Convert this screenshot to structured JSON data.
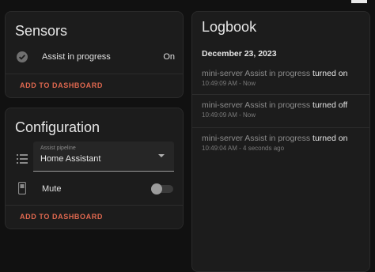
{
  "sensors": {
    "title": "Sensors",
    "item_label": "Assist in progress",
    "item_value": "On",
    "action_label": "ADD TO DASHBOARD"
  },
  "configuration": {
    "title": "Configuration",
    "pipeline_label": "Assist pipeline",
    "pipeline_value": "Home Assistant",
    "mute_label": "Mute",
    "mute_on": false,
    "action_label": "ADD TO DASHBOARD"
  },
  "logbook": {
    "title": "Logbook",
    "date": "December 23, 2023",
    "entries": [
      {
        "entity": "mini-server Assist in progress",
        "action": "turned on",
        "time": "10:49:09 AM",
        "relative": "Now"
      },
      {
        "entity": "mini-server Assist in progress",
        "action": "turned off",
        "time": "10:49:09 AM",
        "relative": "Now"
      },
      {
        "entity": "mini-server Assist in progress",
        "action": "turned on",
        "time": "10:49:04 AM",
        "relative": "4 seconds ago"
      }
    ]
  },
  "colors": {
    "accent": "#e0684f",
    "background": "#111111",
    "card": "#1c1c1c"
  },
  "icons": [
    "check-circle-icon",
    "list-icon",
    "device-icon",
    "chevron-down-icon"
  ]
}
